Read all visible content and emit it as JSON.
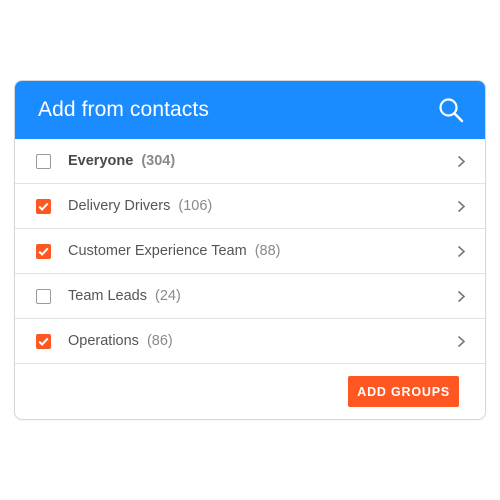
{
  "colors": {
    "header_bg": "#1a8cff",
    "accent": "#ff5722"
  },
  "header": {
    "title": "Add from contacts",
    "search_icon": "search-icon"
  },
  "groups": [
    {
      "name": "Everyone",
      "count": "(304)",
      "checked": false,
      "bold": true
    },
    {
      "name": "Delivery Drivers",
      "count": "(106)",
      "checked": true,
      "bold": false
    },
    {
      "name": "Customer Experience Team",
      "count": "(88)",
      "checked": true,
      "bold": false
    },
    {
      "name": "Team Leads",
      "count": "(24)",
      "checked": false,
      "bold": false
    },
    {
      "name": "Operations",
      "count": "(86)",
      "checked": true,
      "bold": false
    }
  ],
  "footer": {
    "add_label": "ADD GROUPS"
  }
}
